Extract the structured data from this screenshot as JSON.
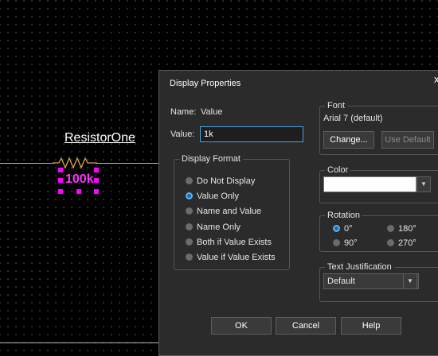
{
  "schematic": {
    "component_name": "ResistorOne",
    "component_value": "100k"
  },
  "dialog": {
    "title": "Display Properties",
    "close_glyph": "x",
    "name_label": "Name:",
    "name_value": "Value",
    "value_label": "Value:",
    "value_input": "1k",
    "display_format": {
      "legend": "Display Format",
      "options": [
        {
          "label": "Do Not Display",
          "selected": false
        },
        {
          "label": "Value Only",
          "selected": true
        },
        {
          "label": "Name and Value",
          "selected": false
        },
        {
          "label": "Name Only",
          "selected": false
        },
        {
          "label": "Both if Value Exists",
          "selected": false
        },
        {
          "label": "Value if Value Exists",
          "selected": false
        }
      ]
    },
    "font": {
      "legend": "Font",
      "current": "Arial 7 (default)",
      "change_label": "Change...",
      "use_default_label": "Use Default"
    },
    "color": {
      "legend": "Color",
      "value": "#ffffff"
    },
    "rotation": {
      "legend": "Rotation",
      "options": [
        {
          "label": "0°",
          "selected": true
        },
        {
          "label": "180°",
          "selected": false
        },
        {
          "label": "90°",
          "selected": false
        },
        {
          "label": "270°",
          "selected": false
        }
      ]
    },
    "justification": {
      "legend": "Text Justification",
      "selected": "Default"
    },
    "buttons": {
      "ok": "OK",
      "cancel": "Cancel",
      "help": "Help"
    }
  },
  "colors": {
    "accent": "#4aa3df",
    "selection": "#ff00ff",
    "dialog_bg": "#2b2b2b"
  }
}
